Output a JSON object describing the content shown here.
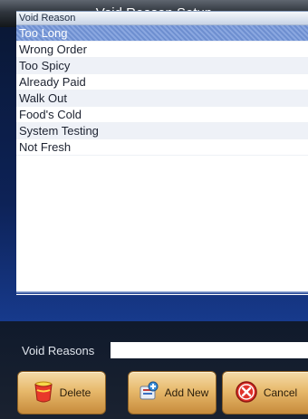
{
  "window": {
    "title": "Void Reason Setup"
  },
  "list": {
    "header": "Void Reason",
    "items": [
      {
        "label": "Too Long",
        "selected": true
      },
      {
        "label": "Wrong Order",
        "selected": false
      },
      {
        "label": "Too Spicy",
        "selected": false
      },
      {
        "label": "Already Paid",
        "selected": false
      },
      {
        "label": "Walk Out",
        "selected": false
      },
      {
        "label": "Food's Cold",
        "selected": false
      },
      {
        "label": "System Testing",
        "selected": false
      },
      {
        "label": "Not Fresh",
        "selected": false
      }
    ]
  },
  "form": {
    "label": "Void Reasons",
    "value": ""
  },
  "buttons": {
    "delete": {
      "label": "Delete",
      "icon": "bucket-icon"
    },
    "add": {
      "label": "Add New",
      "icon": "add-icon"
    },
    "cancel": {
      "label": "Cancel",
      "icon": "cancel-icon"
    }
  },
  "colors": {
    "selected_row": "#7b9ad8",
    "button_gradient_top": "#f5dba8",
    "button_gradient_bottom": "#c78b3b"
  }
}
